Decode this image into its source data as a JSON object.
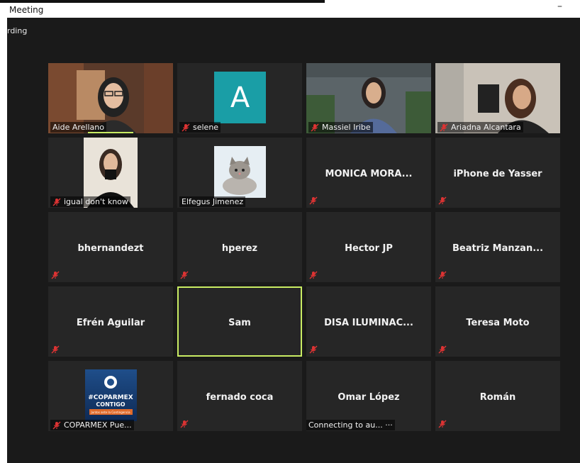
{
  "window": {
    "title": "Meeting",
    "minimize_glyph": "–"
  },
  "meeting": {
    "recording_label": "rding"
  },
  "colors": {
    "active_speaker": "#c9ec63",
    "avatar_a": "#1a9ea6",
    "tile_bg": "#262626",
    "background": "#1a1a1a"
  },
  "participants": [
    {
      "name": "Aide Arellano",
      "video": true,
      "muted": false
    },
    {
      "name": "selene",
      "avatar_letter": "A",
      "muted": true
    },
    {
      "name": "Massiel Iribe",
      "video": true,
      "muted": true
    },
    {
      "name": "Ariadna Alcantara",
      "video": true,
      "muted": true
    },
    {
      "name": "igual don't know",
      "video": true,
      "muted": true
    },
    {
      "name": "Elfegus Jimenez",
      "video": true,
      "muted": false
    },
    {
      "name": "MONICA  MORA...",
      "muted": true
    },
    {
      "name": "iPhone de Yasser",
      "muted": true
    },
    {
      "name": "bhernandezt",
      "muted": true
    },
    {
      "name": "hperez",
      "muted": true
    },
    {
      "name": "Hector JP",
      "muted": true
    },
    {
      "name": "Beatriz  Manzan...",
      "muted": true
    },
    {
      "name": "Efrén Aguilar",
      "muted": true
    },
    {
      "name": "Sam",
      "muted": false,
      "active_speaker": true
    },
    {
      "name": "DISA  ILUMINAC...",
      "muted": true
    },
    {
      "name": "Teresa Moto",
      "muted": true
    },
    {
      "name": "COPARMEX Pue...",
      "video": true,
      "muted": true
    },
    {
      "name": "fernado coca",
      "muted": true
    },
    {
      "name": "Omar López",
      "status": "Connecting to au... ···"
    },
    {
      "name": "Román",
      "muted": true
    }
  ],
  "coparmex_logo": {
    "line1": "#COPARMEX",
    "line2": "CONTIGO",
    "line3": "Juntos ante la Contingencia"
  },
  "icons": {
    "mute": "muted-microphone-icon"
  }
}
